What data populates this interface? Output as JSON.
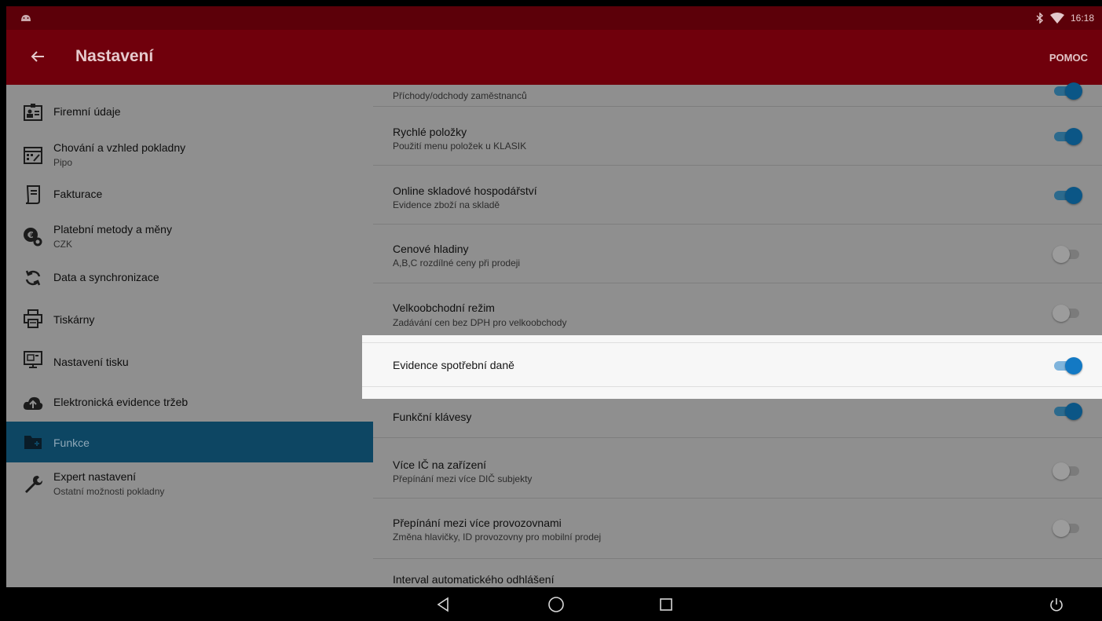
{
  "status_bar": {
    "time": "16:18",
    "icons": [
      "android-icon",
      "bluetooth-icon",
      "wifi-icon"
    ]
  },
  "app_bar": {
    "title": "Nastavení",
    "help_label": "POMOC"
  },
  "sidebar": {
    "items": [
      {
        "label": "Firemní údaje",
        "sub": "",
        "icon": "company-card-icon",
        "active": false
      },
      {
        "label": "Chování a vzhled pokladny",
        "sub": "Pipo",
        "icon": "register-icon",
        "active": false
      },
      {
        "label": "Fakturace",
        "sub": "",
        "icon": "invoice-icon",
        "active": false
      },
      {
        "label": "Platební metody a měny",
        "sub": "CZK",
        "icon": "currency-settings-icon",
        "active": false
      },
      {
        "label": "Data a synchronizace",
        "sub": "",
        "icon": "sync-icon",
        "active": false
      },
      {
        "label": "Tiskárny",
        "sub": "",
        "icon": "printer-icon",
        "active": false
      },
      {
        "label": "Nastavení tisku",
        "sub": "",
        "icon": "print-settings-icon",
        "active": false
      },
      {
        "label": "Elektronická evidence tržeb",
        "sub": "",
        "icon": "cloud-upload-icon",
        "active": false
      },
      {
        "label": "Funkce",
        "sub": "",
        "icon": "folder-plus-icon",
        "active": true
      },
      {
        "label": "Expert nastavení",
        "sub": "Ostatní možnosti pokladny",
        "icon": "wrench-icon",
        "active": false
      }
    ]
  },
  "preferences": [
    {
      "title": "",
      "sub": "Příchody/odchody zaměstnanců",
      "on": true
    },
    {
      "title": "Rychlé položky",
      "sub": "Použití menu položek u KLASIK",
      "on": true
    },
    {
      "title": "Online skladové hospodářství",
      "sub": "Evidence zboží na skladě",
      "on": true
    },
    {
      "title": "Cenové hladiny",
      "sub": "A,B,C rozdílné ceny při prodeji",
      "on": false
    },
    {
      "title": "Velkoobchodní režim",
      "sub": "Zadávání cen bez DPH pro velkoobchody",
      "on": false
    },
    {
      "title": "Evidence spotřební daně",
      "sub": "",
      "on": true
    },
    {
      "title": "Funkční klávesy",
      "sub": "",
      "on": true
    },
    {
      "title": "Více IČ na zařízení",
      "sub": "Přepínání mezi více DIČ subjekty",
      "on": false
    },
    {
      "title": "Přepínání mezi více provozovnami",
      "sub": "Změna hlavičky, ID provozovny pro mobilní prodej",
      "on": false
    },
    {
      "title": "Interval automatického odhlášení",
      "sub": "",
      "on": null
    }
  ],
  "colors": {
    "status_bar": "#5c0009",
    "app_bar": "#70000c",
    "active_item": "#0d4663",
    "switch_on": "#0b5686",
    "highlight": "#f7f7f7"
  },
  "nav_bar": {
    "buttons": [
      "back-triangle-icon",
      "home-circle-icon",
      "recents-square-icon",
      "power-icon"
    ]
  }
}
